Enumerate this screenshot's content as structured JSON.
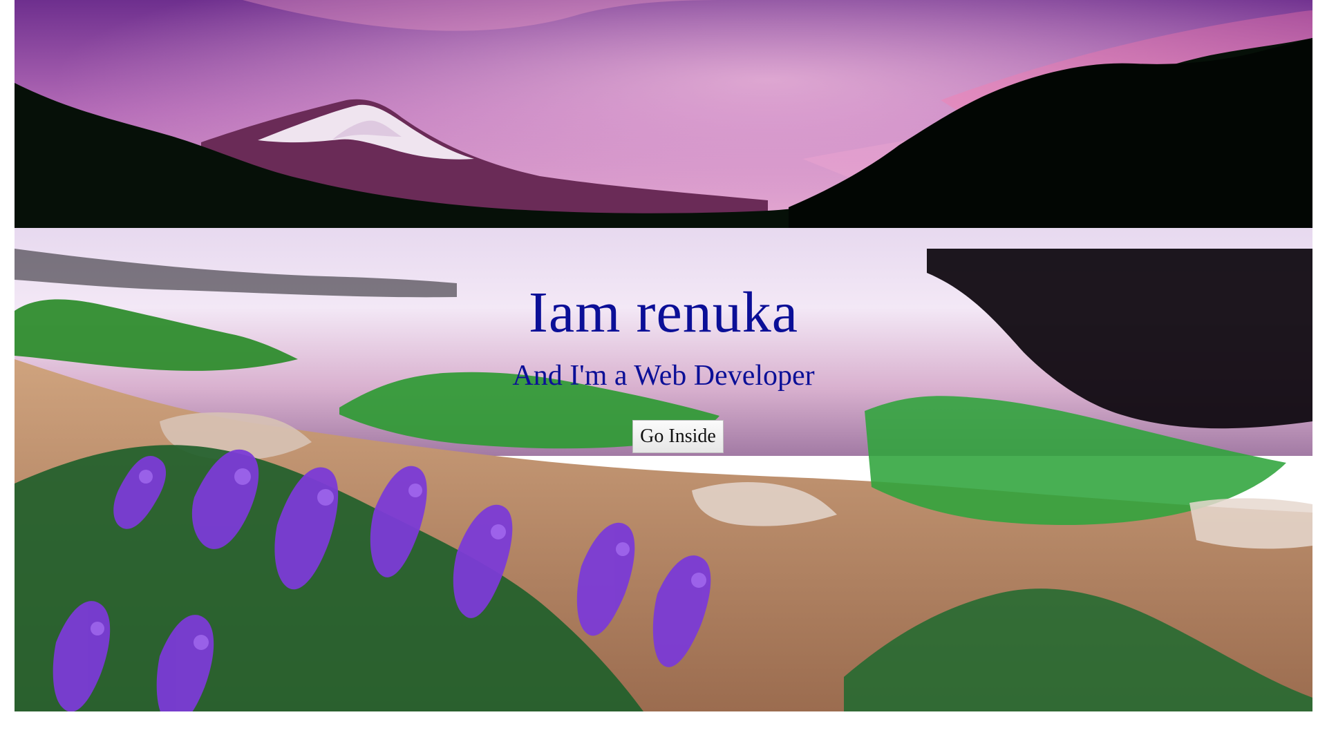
{
  "hero": {
    "title": "Iam renuka",
    "subtitle": "And I'm a Web Developer",
    "button_label": "Go Inside"
  },
  "colors": {
    "heading": "#0b0f97",
    "button_bg": "#ececec",
    "button_text": "#111111"
  },
  "background": {
    "subject": "mountain lake at sunset with purple lupine flowers in the foreground"
  }
}
